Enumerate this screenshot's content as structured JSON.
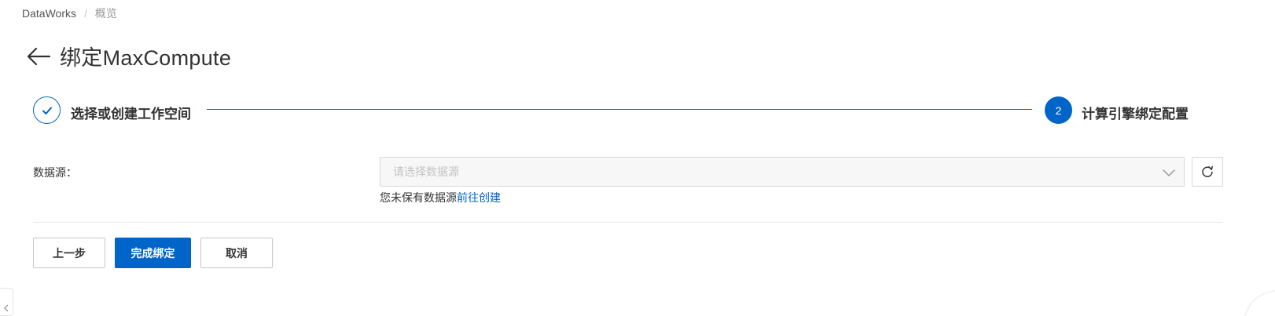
{
  "breadcrumb": {
    "root": "DataWorks",
    "separator": "/",
    "current": "概览"
  },
  "header": {
    "back_icon": "arrow-left-icon",
    "title": "绑定MaxCompute"
  },
  "steps": [
    {
      "label": "选择或创建工作空间",
      "state": "completed",
      "icon": "check-icon"
    },
    {
      "label": "计算引擎绑定配置",
      "state": "active",
      "number": "2"
    }
  ],
  "form": {
    "datasource": {
      "label": "数据源：",
      "placeholder": "请选择数据源",
      "hint_text": "您未保有数据源",
      "hint_link": "前往创建"
    }
  },
  "actions": {
    "prev_label": "上一步",
    "finish_label": "完成绑定",
    "cancel_label": "取消"
  },
  "colors": {
    "accent": "#0064c8",
    "border": "#d7d7d7",
    "text": "#333333",
    "muted": "#999999"
  }
}
